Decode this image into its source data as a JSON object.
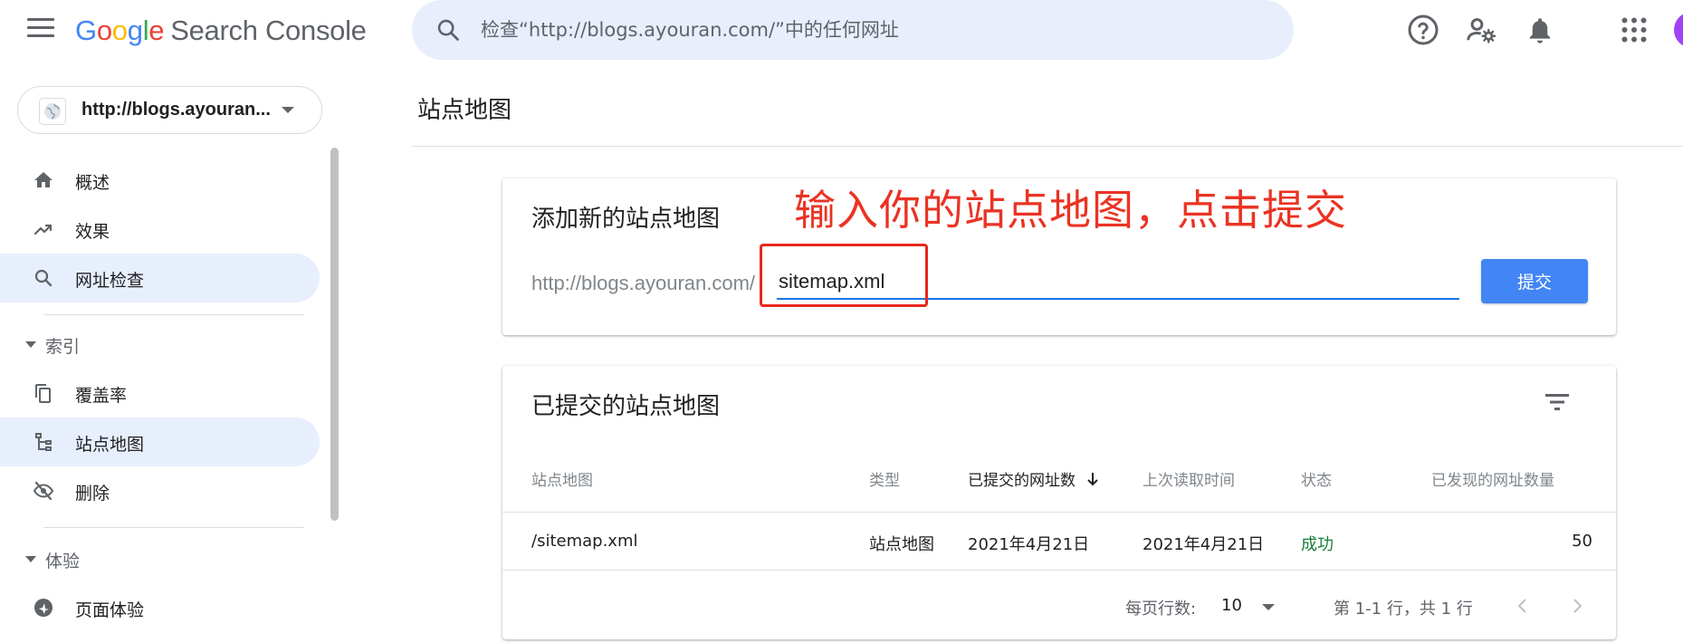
{
  "app": {
    "logo_letters": [
      "G",
      "o",
      "o",
      "g",
      "l",
      "e"
    ],
    "product": "Search Console",
    "search_placeholder": "检查“http://blogs.ayouran.com/”中的任何网址"
  },
  "header_icons": [
    "menu-icon",
    "help-icon",
    "manage-users-icon",
    "notifications-icon",
    "apps-icon",
    "avatar"
  ],
  "sidebar": {
    "property": "http://blogs.ayouran...",
    "items_top": [
      {
        "label": "概述",
        "icon": "home-icon"
      },
      {
        "label": "效果",
        "icon": "trending-up-icon"
      },
      {
        "label": "网址检查",
        "icon": "search-icon",
        "active": true
      }
    ],
    "section_index": {
      "label": "索引",
      "items": [
        {
          "label": "覆盖率",
          "icon": "coverage-icon"
        },
        {
          "label": "站点地图",
          "icon": "sitemap-icon",
          "active": true
        },
        {
          "label": "删除",
          "icon": "removals-icon"
        }
      ]
    },
    "section_experience": {
      "label": "体验",
      "items": [
        {
          "label": "页面体验",
          "icon": "page-experience-icon"
        }
      ]
    }
  },
  "main": {
    "page_title": "站点地图",
    "add_card": {
      "title": "添加新的站点地图",
      "prefix": "http://blogs.ayouran.com/",
      "input_value": "sitemap.xml",
      "submit_label": "提交",
      "annotation": "输入你的站点地图，点击提交"
    },
    "submitted_card": {
      "title": "已提交的站点地图",
      "headers": [
        "站点地图",
        "类型",
        "已提交的网址数",
        "上次读取时间",
        "状态",
        "已发现的网址数量"
      ],
      "rows": [
        {
          "sitemap": "/sitemap.xml",
          "type": "站点地图",
          "submitted": "2021年4月21日",
          "last_read": "2021年4月21日",
          "status": "成功",
          "discovered": "50"
        }
      ],
      "pagination": {
        "rows_per_page_label": "每页行数:",
        "rows_per_page": "10",
        "range": "第 1-1 行，共 1 行"
      }
    }
  },
  "colors": {
    "accent": "#4285f4",
    "active_nav_bg": "#e8effc",
    "success": "#188038",
    "annotation_red": "#ea3323"
  }
}
